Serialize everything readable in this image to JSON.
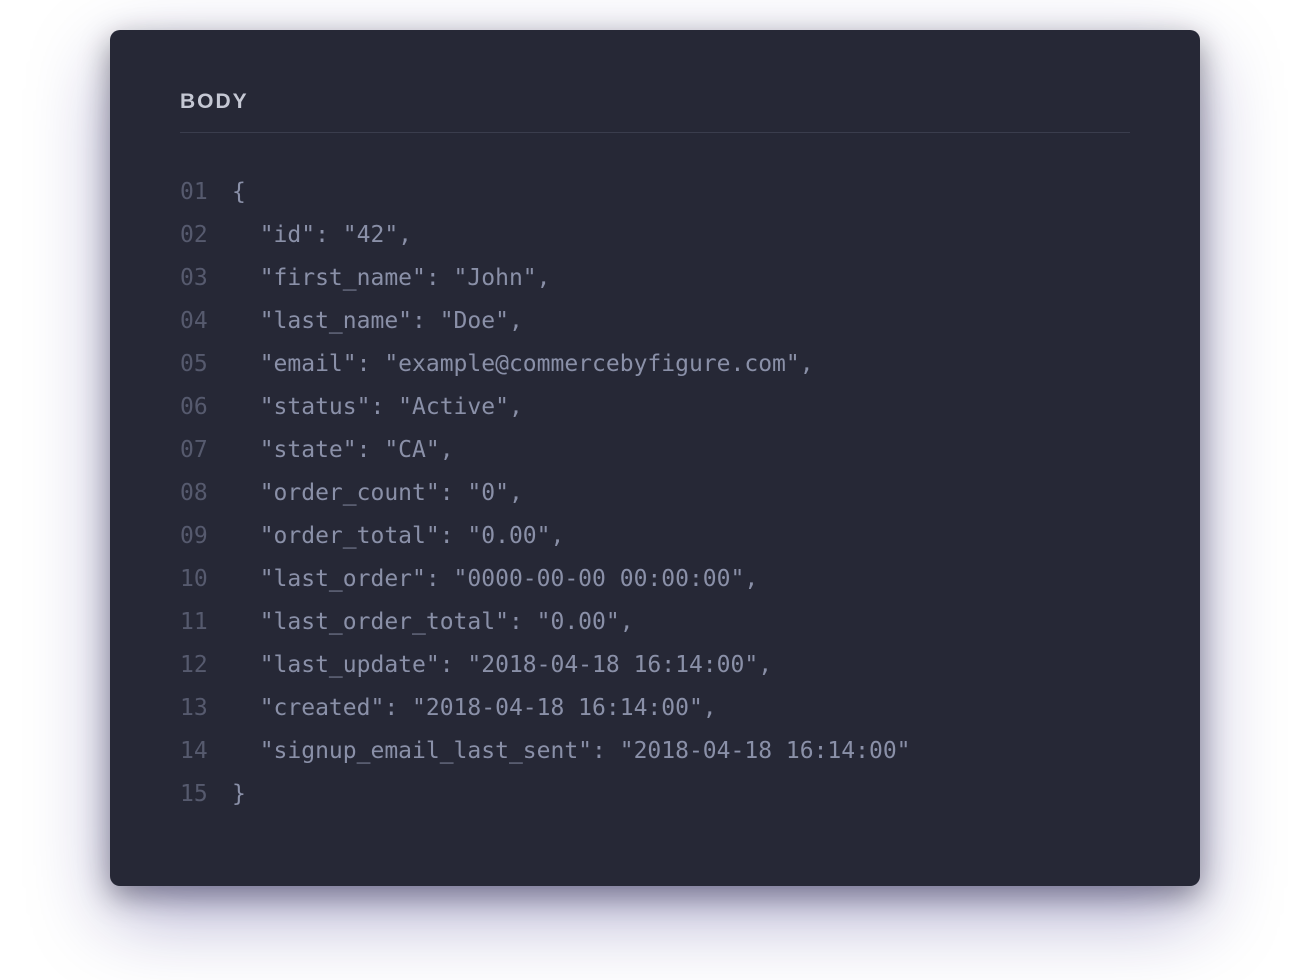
{
  "header": {
    "title": "BODY"
  },
  "code": {
    "lines": [
      {
        "num": "01",
        "content": "{"
      },
      {
        "num": "02",
        "content": "  \"id\": \"42\","
      },
      {
        "num": "03",
        "content": "  \"first_name\": \"John\","
      },
      {
        "num": "04",
        "content": "  \"last_name\": \"Doe\","
      },
      {
        "num": "05",
        "content": "  \"email\": \"example@commercebyfigure.com\","
      },
      {
        "num": "06",
        "content": "  \"status\": \"Active\","
      },
      {
        "num": "07",
        "content": "  \"state\": \"CA\","
      },
      {
        "num": "08",
        "content": "  \"order_count\": \"0\","
      },
      {
        "num": "09",
        "content": "  \"order_total\": \"0.00\","
      },
      {
        "num": "10",
        "content": "  \"last_order\": \"0000-00-00 00:00:00\","
      },
      {
        "num": "11",
        "content": "  \"last_order_total\": \"0.00\","
      },
      {
        "num": "12",
        "content": "  \"last_update\": \"2018-04-18 16:14:00\","
      },
      {
        "num": "13",
        "content": "  \"created\": \"2018-04-18 16:14:00\","
      },
      {
        "num": "14",
        "content": "  \"signup_email_last_sent\": \"2018-04-18 16:14:00\""
      },
      {
        "num": "15",
        "content": "}"
      }
    ]
  }
}
